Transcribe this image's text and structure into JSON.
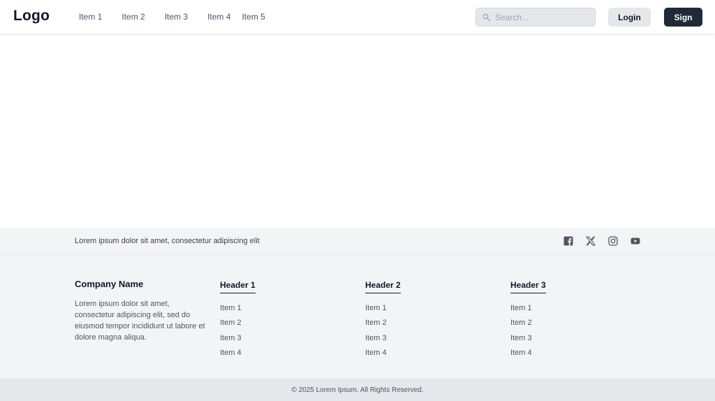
{
  "header": {
    "logo": "Logo",
    "nav": [
      "Item 1",
      "Item 2",
      "Item 3",
      "Item 4",
      "Item 5"
    ],
    "search_placeholder": "Search...",
    "login_label": "Login",
    "sign_label": "Sign"
  },
  "footer": {
    "tagline": "Lorem ipsum dolor sit amet, consectetur adipiscing elit",
    "social_icons": [
      "facebook-icon",
      "x-icon",
      "instagram-icon",
      "youtube-icon"
    ],
    "company": {
      "name": "Company Name",
      "description": "Lorem ipsum dolor sit amet, consectetur adipiscing elit, sed do eiusmod tempor incididunt ut labore et dolore magna aliqua."
    },
    "columns": [
      {
        "header": "Header 1",
        "items": [
          "Item 1",
          "Item 2",
          "Item 3",
          "Item 4"
        ]
      },
      {
        "header": "Header 2",
        "items": [
          "Item 1",
          "Item 2",
          "Item 3",
          "Item 4"
        ]
      },
      {
        "header": "Header 3",
        "items": [
          "Item 1",
          "Item 2",
          "Item 3",
          "Item 4"
        ]
      }
    ],
    "copyright": "© 2025 Lorem Ipsum. All Rights Reserved."
  },
  "colors": {
    "primary_dark": "#1f2937",
    "footer_bg": "#f3f4f6",
    "footer_bottom_bg": "#e5e7eb",
    "text_muted": "#4b5563"
  }
}
